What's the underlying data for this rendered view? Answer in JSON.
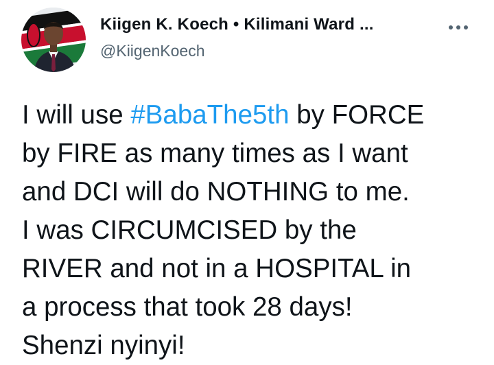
{
  "tweet": {
    "author": {
      "display_name": "Kiigen K. Koech • Kilimani Ward ...",
      "handle": "@KiigenKoech",
      "avatar_icon": "kenyan-flag-avatar"
    },
    "more_icon": "more-horizontal-icon",
    "body": {
      "prefix": "I will use ",
      "hashtag": "#BabaThe5th",
      "suffix": " by FORCE\nby FIRE as many times as I want\nand DCI will do NOTHING to me.\nI was CIRCUMCISED by the\nRIVER and not in a HOSPITAL in\na process that took 28 days!\nShenzi nyinyi!"
    },
    "colors": {
      "text": "#0f1419",
      "secondary_text": "#536471",
      "link": "#1d9bf0"
    }
  }
}
